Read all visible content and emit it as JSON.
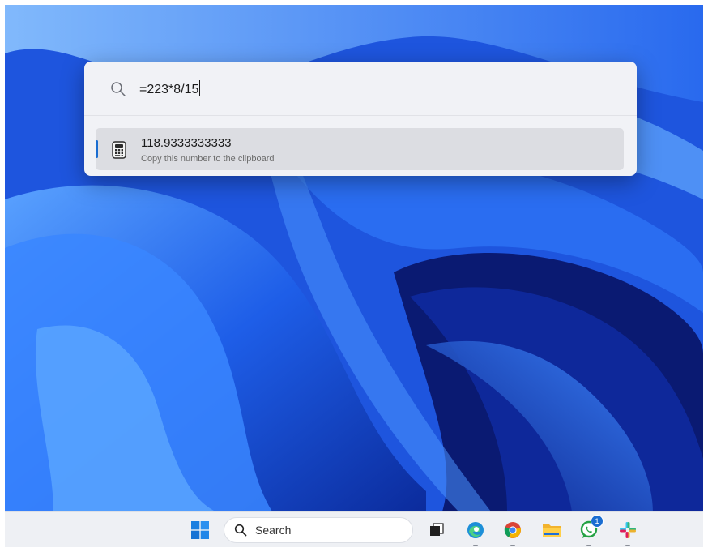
{
  "run": {
    "query": "=223*8/15",
    "result": {
      "value": "118.9333333333",
      "subtitle": "Copy this number to the clipboard"
    }
  },
  "taskbar": {
    "search_label": "Search",
    "whatsapp_badge": "1"
  },
  "colors": {
    "accent": "#1a6dd1",
    "wallpaper_blue": "#1d4fd6",
    "run_background": "#f1f2f6",
    "selected_row": "#dcdde2"
  }
}
